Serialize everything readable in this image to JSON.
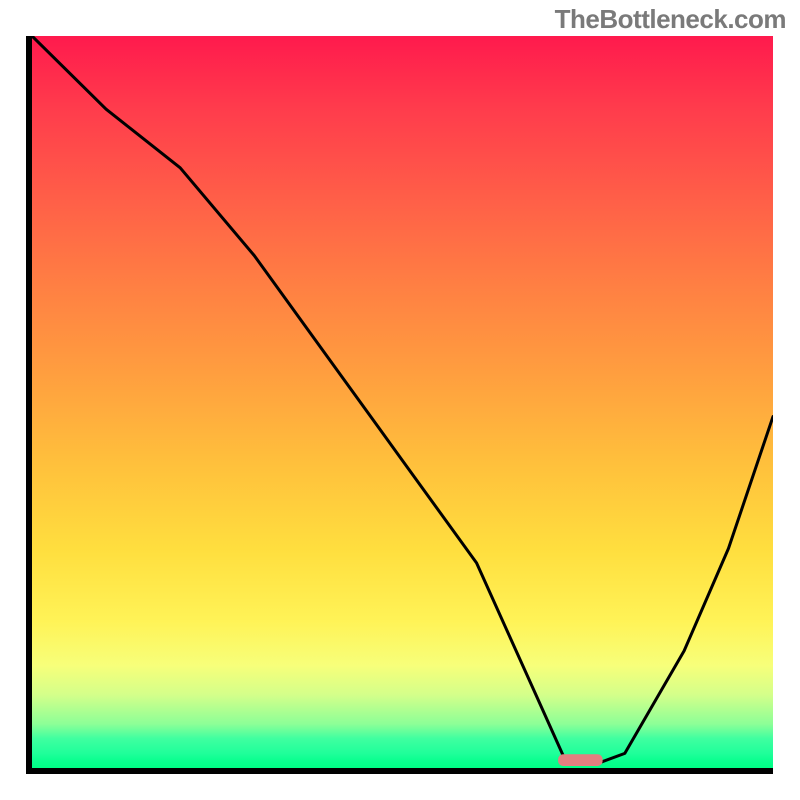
{
  "watermark": "TheBottleneck.com",
  "chart_data": {
    "type": "line",
    "title": "",
    "xlabel": "",
    "ylabel": "",
    "xlim": [
      0,
      100
    ],
    "ylim": [
      0,
      100
    ],
    "series": [
      {
        "name": "bottleneck-curve",
        "x": [
          0,
          10,
          20,
          30,
          40,
          50,
          60,
          68,
          72,
          76,
          80,
          88,
          94,
          100
        ],
        "y": [
          100,
          90,
          82,
          70,
          56,
          42,
          28,
          10,
          1,
          0.5,
          2,
          16,
          30,
          48
        ]
      }
    ],
    "annotations": [
      {
        "name": "minimum-marker",
        "type": "bar",
        "x": 74,
        "width_pct": 6,
        "height_pct": 1.6,
        "color": "#e37f80"
      }
    ],
    "colors": {
      "gradient_top": "#ff1a4d",
      "gradient_mid": "#ffde3e",
      "gradient_bottom": "#00ff85",
      "curve": "#000000",
      "axis": "#000000",
      "marker": "#e37f80"
    },
    "grid": false,
    "legend": "none"
  }
}
